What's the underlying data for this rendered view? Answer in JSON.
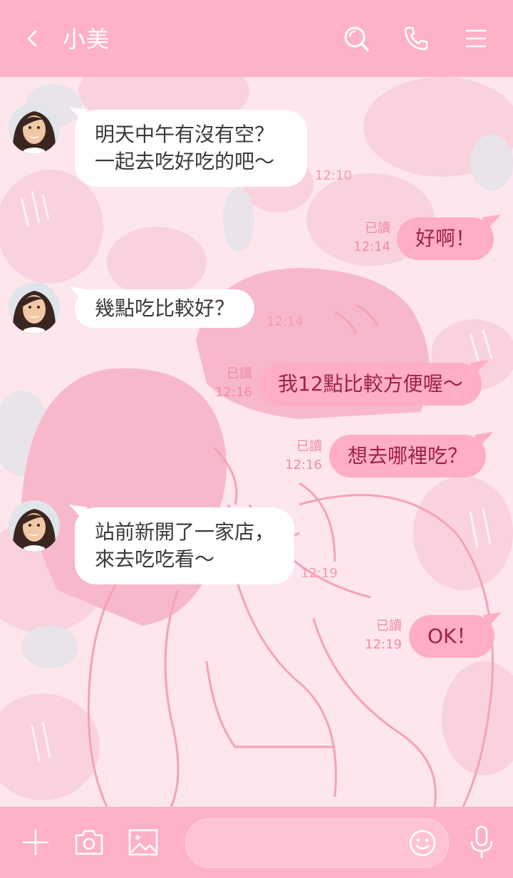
{
  "header": {
    "title": "小美",
    "bg_color": "#ffb1c6",
    "icons": [
      "back-icon",
      "search-icon",
      "phone-icon",
      "menu-icon"
    ]
  },
  "messages": [
    {
      "side": "in",
      "lines": [
        "明天中午有沒有空？",
        "一起去吃好吃的吧～"
      ],
      "time": "12:10"
    },
    {
      "side": "out",
      "text": "好啊！",
      "read": "已讀",
      "time": "12:14"
    },
    {
      "side": "in",
      "text": "幾點吃比較好？",
      "time": "12:14"
    },
    {
      "side": "out",
      "text": "我12點比較方便喔～",
      "read": "已讀",
      "time": "12:16"
    },
    {
      "side": "out",
      "text": "想去哪裡吃？",
      "read": "已讀",
      "time": "12:16"
    },
    {
      "side": "in",
      "lines": [
        "站前新開了一家店，",
        "來去吃吃看～"
      ],
      "time": "12:19"
    },
    {
      "side": "out",
      "text": "OK！",
      "read": "已讀",
      "time": "12:19"
    }
  ],
  "footer": {
    "icons": [
      "plus-icon",
      "camera-icon",
      "image-icon",
      "emoji-icon",
      "mic-icon"
    ],
    "input_placeholder": ""
  },
  "colors": {
    "accent": "#ffb1c6",
    "chat_bg": "#fde6ec",
    "outgoing_bubble": "#ffaec4",
    "outgoing_text": "#9d2147",
    "incoming_bubble": "#ffffff",
    "incoming_text": "#3a3a3a"
  }
}
